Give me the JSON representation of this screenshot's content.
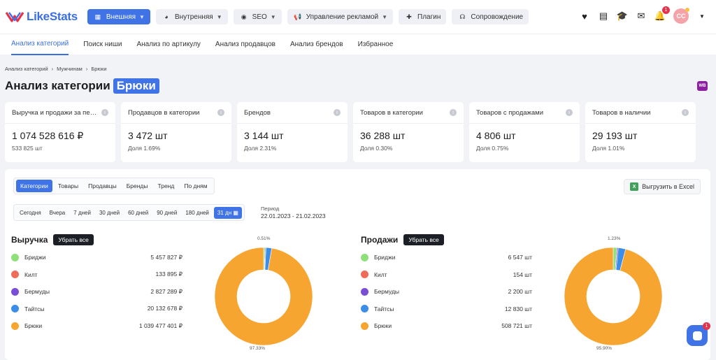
{
  "header": {
    "logo": "LikeStats",
    "nav": [
      {
        "label": "Внешняя",
        "icon": "grid-icon",
        "active": true,
        "chevron": true
      },
      {
        "label": "Внутренняя",
        "icon": "pie-icon",
        "active": false,
        "chevron": true
      },
      {
        "label": "SEO",
        "icon": "chat-icon",
        "active": false,
        "chevron": true
      },
      {
        "label": "Управление рекламой",
        "icon": "megaphone-icon",
        "active": false,
        "chevron": true
      },
      {
        "label": "Плагин",
        "icon": "puzzle-icon",
        "active": false,
        "chevron": false
      },
      {
        "label": "Сопровождение",
        "icon": "headset-icon",
        "active": false,
        "chevron": false
      }
    ],
    "bell_count": "1",
    "avatar_initials": "СС"
  },
  "subnav": [
    "Анализ категорий",
    "Поиск ниши",
    "Анализ по артикулу",
    "Анализ продавцов",
    "Анализ брендов",
    "Избранное"
  ],
  "breadcrumb": [
    "Анализ категорий",
    "Мужчинам",
    "Брюки"
  ],
  "title": {
    "prefix": "Анализ категории",
    "highlight": "Брюки"
  },
  "wb_badge": "WB",
  "cards": [
    {
      "title": "Выручка и продажи за период",
      "value": "1 074 528 616 ₽",
      "sub": "533 825 шт"
    },
    {
      "title": "Продавцов в категории",
      "value": "3 472 шт",
      "sub": "Доля 1.69%"
    },
    {
      "title": "Брендов",
      "value": "3 144 шт",
      "sub": "Доля 2.31%"
    },
    {
      "title": "Товаров в категории",
      "value": "36 288 шт",
      "sub": "Доля 0.30%"
    },
    {
      "title": "Товаров с продажами",
      "value": "4 806 шт",
      "sub": "Доля 0.75%"
    },
    {
      "title": "Товаров в наличии",
      "value": "29 193 шт",
      "sub": "Доля 1.01%"
    }
  ],
  "tabs": [
    "Категории",
    "Товары",
    "Продавцы",
    "Бренды",
    "Тренд",
    "По дням"
  ],
  "periods": [
    "Сегодня",
    "Вчера",
    "7 дней",
    "30 дней",
    "60 дней",
    "90 дней",
    "180 дней",
    "31 дн"
  ],
  "period_label": "Период",
  "period_range": "22.01.2023 - 21.02.2023",
  "excel_label": "Выгрузить в Excel",
  "clear_label": "Убрать все",
  "chat_count": "1",
  "chart_data": [
    {
      "type": "pie",
      "title": "Выручка",
      "categories": [
        "Бриджи",
        "Килт",
        "Бермуды",
        "Тайтсы",
        "Брюки"
      ],
      "values": [
        5457827,
        133895,
        2827289,
        20132678,
        1039477401
      ],
      "labels": [
        "5 457 827 ₽",
        "133 895 ₽",
        "2 827 289 ₽",
        "20 132 678 ₽",
        "1 039 477 401 ₽"
      ],
      "colors": [
        "#8fe07a",
        "#ef6b5a",
        "#7a4fd6",
        "#3c8ee8",
        "#f7a531"
      ],
      "annotations": [
        "0.51%",
        "97.33%"
      ]
    },
    {
      "type": "pie",
      "title": "Продажи",
      "categories": [
        "Бриджи",
        "Килт",
        "Бермуды",
        "Тайтсы",
        "Брюки"
      ],
      "values": [
        6547,
        154,
        2200,
        12830,
        508721
      ],
      "labels": [
        "6 547 шт",
        "154 шт",
        "2 200 шт",
        "12 830 шт",
        "508 721 шт"
      ],
      "colors": [
        "#8fe07a",
        "#ef6b5a",
        "#7a4fd6",
        "#3c8ee8",
        "#f7a531"
      ],
      "annotations": [
        "1.23%",
        "95.90%"
      ]
    }
  ]
}
